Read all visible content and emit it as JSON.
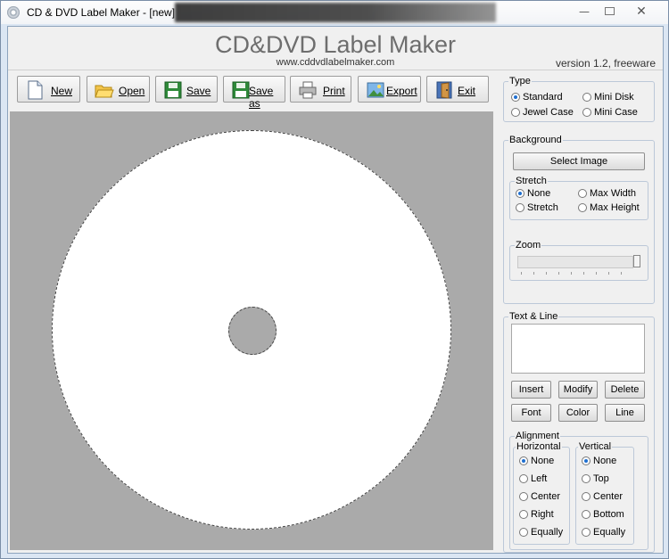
{
  "window": {
    "title": "CD & DVD Label Maker - [new]",
    "minimize_icon": "minimize-icon",
    "maximize_icon": "maximize-icon",
    "close_icon": "close-icon"
  },
  "header": {
    "title": "CD&DVD Label Maker",
    "url": "www.cddvdlabelmaker.com",
    "version": "version 1.2, freeware"
  },
  "toolbar": {
    "new_label": "New",
    "open_label": "Open",
    "save_label": "Save",
    "saveas_label": "Save as",
    "print_label": "Print",
    "export_label": "Export",
    "exit_label": "Exit"
  },
  "type": {
    "legend": "Type",
    "standard": "Standard",
    "mini_disk": "Mini Disk",
    "jewel_case": "Jewel Case",
    "mini_case": "Mini Case",
    "selected": "Standard"
  },
  "background": {
    "legend": "Background",
    "select_image": "Select Image",
    "stretch": {
      "legend": "Stretch",
      "none": "None",
      "max_width": "Max Width",
      "stretch": "Stretch",
      "max_height": "Max Height",
      "selected": "None"
    },
    "zoom": {
      "legend": "Zoom",
      "value": 1.0
    }
  },
  "text_line": {
    "legend": "Text & Line",
    "text_value": "",
    "insert": "Insert",
    "modify": "Modify",
    "delete": "Delete",
    "font": "Font",
    "color": "Color",
    "line": "Line"
  },
  "alignment": {
    "legend": "Alignment",
    "horizontal": {
      "legend": "Horizontal",
      "options": [
        "None",
        "Left",
        "Center",
        "Right",
        "Equally"
      ],
      "selected": "None"
    },
    "vertical": {
      "legend": "Vertical",
      "options": [
        "None",
        "Top",
        "Center",
        "Bottom",
        "Equally"
      ],
      "selected": "None"
    }
  },
  "colors": {
    "canvas_bg": "#aaaaaa",
    "disc": "#ffffff",
    "radio_selected": "#1f6fd0"
  }
}
